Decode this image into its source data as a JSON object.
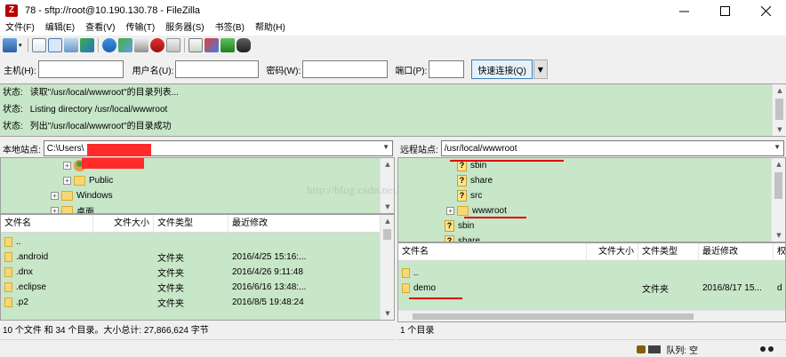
{
  "window": {
    "title": "78 - sftp://root@10.190.130.78 - FileZilla",
    "icon_text": "Z"
  },
  "menu": [
    "文件(F)",
    "编辑(E)",
    "查看(V)",
    "传输(T)",
    "服务器(S)",
    "书签(B)",
    "帮助(H)"
  ],
  "toolbar": {
    "icons": [
      "site-manager-icon",
      "toggle-log-icon",
      "toggle-local-tree-icon",
      "toggle-remote-tree-icon",
      "toggle-queue-icon",
      "refresh-icon",
      "process-queue-icon",
      "cancel-icon",
      "disconnect-icon",
      "reconnect-icon",
      "directory-compare-icon",
      "sync-browse-icon",
      "filter-icon",
      "search-icon"
    ]
  },
  "quickconnect": {
    "host_label": "主机(H):",
    "host_value": "",
    "user_label": "用户名(U):",
    "user_value": "",
    "pass_label": "密码(W):",
    "pass_value": "",
    "port_label": "端口(P):",
    "port_value": "",
    "button_label": "快速连接(Q)"
  },
  "log": [
    {
      "label": "状态:",
      "text": "读取\"/usr/local/wwwroot\"的目录列表..."
    },
    {
      "label": "状态:",
      "text": "Listing directory /usr/local/wwwroot"
    },
    {
      "label": "状态:",
      "text": "列出\"/usr/local/wwwroot\"的目录成功"
    }
  ],
  "local": {
    "site_label": "本地站点:",
    "site_path": "C:\\Users\\",
    "tree": [
      {
        "label": "",
        "icon": "user-folder"
      },
      {
        "label": "Public",
        "icon": "folder"
      },
      {
        "label": "Windows",
        "icon": "folder"
      },
      {
        "label": "桌面",
        "icon": "folder"
      }
    ],
    "columns": [
      "文件名",
      "文件大小",
      "文件类型",
      "最近修改"
    ],
    "files": [
      {
        "name": "..",
        "size": "",
        "type": "",
        "modified": ""
      },
      {
        "name": ".android",
        "size": "",
        "type": "文件夹",
        "modified": "2016/4/25 15:16:..."
      },
      {
        "name": ".dnx",
        "size": "",
        "type": "文件夹",
        "modified": "2016/4/26 9:11:48"
      },
      {
        "name": ".eclipse",
        "size": "",
        "type": "文件夹",
        "modified": "2016/6/16 13:48:..."
      },
      {
        "name": ".p2",
        "size": "",
        "type": "文件夹",
        "modified": "2016/8/5 19:48:24"
      }
    ],
    "status": "10 个文件 和 34 个目录。大小总计: 27,866,624 字节"
  },
  "remote": {
    "site_label": "远程站点:",
    "site_path": "/usr/local/wwwroot",
    "tree": [
      {
        "label": "sbin",
        "icon": "unknown"
      },
      {
        "label": "share",
        "icon": "unknown"
      },
      {
        "label": "src",
        "icon": "unknown"
      },
      {
        "label": "wwwroot",
        "icon": "folder"
      },
      {
        "label": "sbin",
        "icon": "unknown"
      },
      {
        "label": "share",
        "icon": "unknown"
      }
    ],
    "columns": [
      "文件名",
      "文件大小",
      "文件类型",
      "最近修改",
      "权"
    ],
    "files": [
      {
        "name": "..",
        "size": "",
        "type": "",
        "modified": "",
        "perm": ""
      },
      {
        "name": "demo",
        "size": "",
        "type": "文件夹",
        "modified": "2016/8/17 15...",
        "perm": "d"
      }
    ],
    "status": "1 个目录"
  },
  "bottom": {
    "queue_label": "队列: 空"
  },
  "watermark": "http://blog.csdn.net/",
  "colors": {
    "list_bg": "#c8e6c8",
    "annotation_red": "#e00000"
  }
}
